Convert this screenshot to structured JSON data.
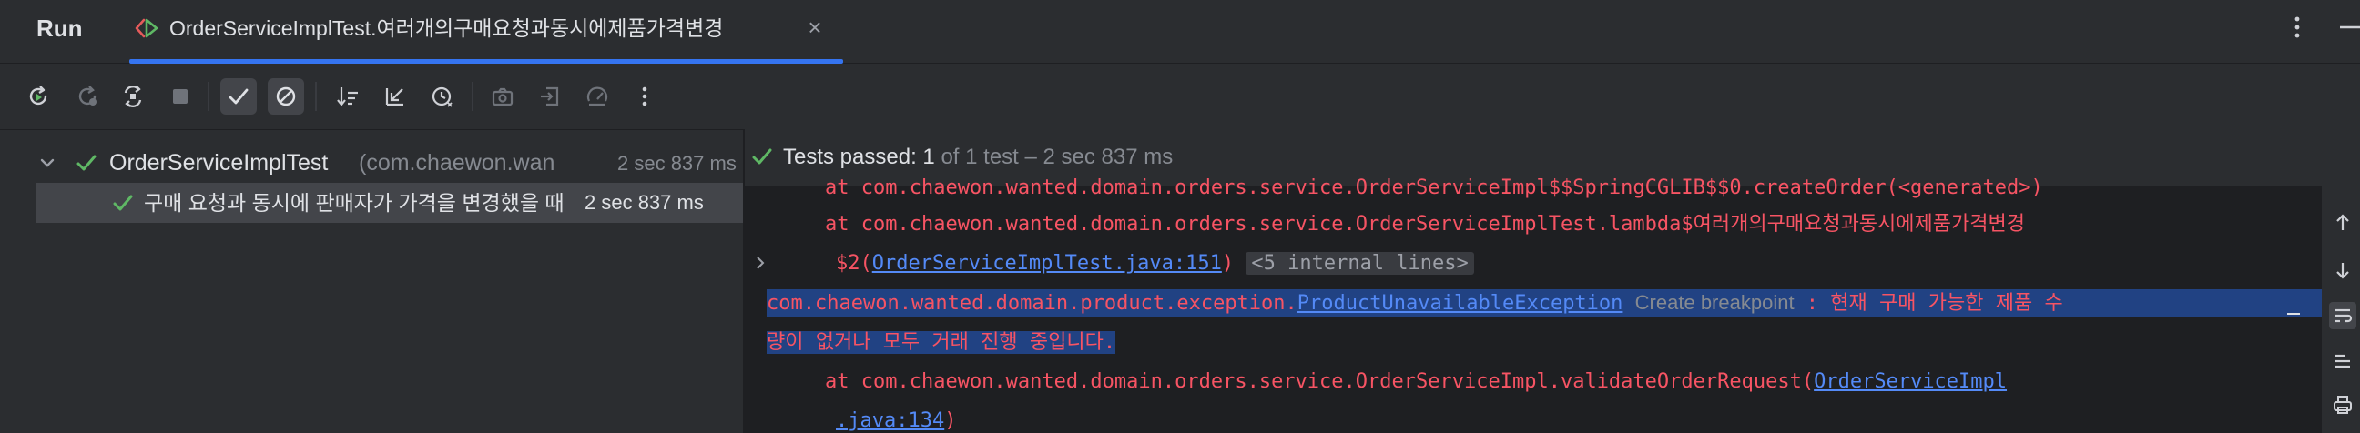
{
  "window": {
    "panel_title": "Run",
    "tab": {
      "label": "OrderServiceImplTest.여러개의구매요청과동시에제품가격변경",
      "close_glyph": "×",
      "icon": "test-run-icon"
    },
    "accent_color": "#3574f0"
  },
  "toolbar": {
    "buttons": [
      {
        "name": "rerun-icon",
        "enabled": true
      },
      {
        "name": "rerun-failed-icon",
        "enabled": false
      },
      {
        "name": "toggle-auto-test-icon",
        "enabled": true
      },
      {
        "name": "stop-icon",
        "enabled": false
      },
      {
        "name": "show-passed-icon",
        "enabled": true,
        "active": true
      },
      {
        "name": "show-ignored-icon",
        "enabled": true,
        "active": true
      },
      {
        "name": "sort-icon",
        "enabled": true
      },
      {
        "name": "import-tests-icon",
        "enabled": true
      },
      {
        "name": "history-icon",
        "enabled": true
      },
      {
        "name": "snapshot-icon",
        "enabled": false
      },
      {
        "name": "export-icon",
        "enabled": false
      },
      {
        "name": "coverage-icon",
        "enabled": false
      },
      {
        "name": "more-icon",
        "enabled": true
      }
    ]
  },
  "tree": {
    "root": {
      "name": "OrderServiceImplTest",
      "package": "(com.chaewon.wan",
      "time": "2 sec 837 ms",
      "status": "passed"
    },
    "child": {
      "name": "구매 요청과 동시에 판매자가 가격을 변경했을 때",
      "time": "2 sec 837 ms",
      "status": "passed"
    }
  },
  "console": {
    "status": {
      "label": "Tests passed:",
      "count": "1",
      "detail": "of 1 test – 2 sec 837 ms"
    },
    "lines": {
      "l1": "at com.chaewon.wanted.domain.orders.service.OrderServiceImpl$$SpringCGLIB$$0.createOrder(<generated>)",
      "l2": "at com.chaewon.wanted.domain.orders.service.OrderServiceImplTest.lambda$여러개의구매요청과동시에제품가격변경",
      "l3_prefix": "$2(",
      "l3_link": "OrderServiceImplTest.java:151",
      "l3_suffix": ")",
      "l3_fold": "<5 internal lines>",
      "l4_prefix": "com.chaewon.wanted.domain.product.exception.",
      "l4_link": "ProductUnavailableException",
      "l4_hint": "Create breakpoint",
      "l4_suffix": " : 현재 구매 가능한 제품 수",
      "l5": "량이 없거나 모두 거래 진행 중입니다.",
      "l6_prefix": "at com.chaewon.wanted.domain.orders.service.OrderServiceImpl.validateOrderRequest(",
      "l6_link": "OrderServiceImpl",
      "l7_link": ".java:134",
      "l7_suffix": ")"
    }
  },
  "colors": {
    "passed": "#5fb865",
    "error_text": "#f75464",
    "link": "#548af7",
    "selection": "#214283"
  }
}
